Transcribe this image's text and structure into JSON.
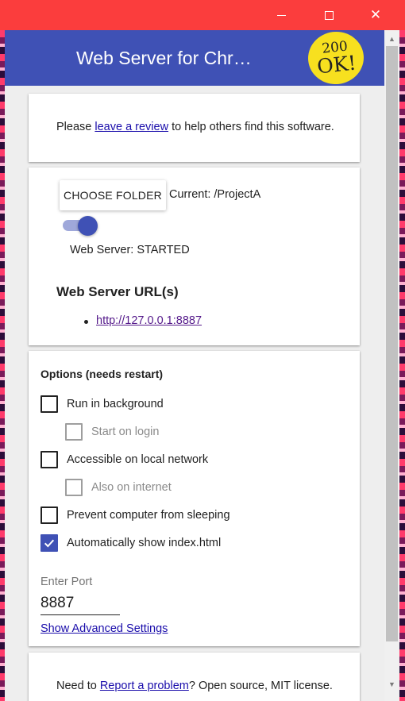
{
  "window": {
    "minimize_symbol": "",
    "close_symbol": "✕"
  },
  "appbar": {
    "title": "Web Server for Chr…",
    "badge_line1": "200",
    "badge_line2": "OK!"
  },
  "review": {
    "prefix": "Please ",
    "link": "leave a review",
    "suffix": " to help others find this software."
  },
  "server": {
    "choose_folder_label": "CHOOSE FOLDER",
    "current_folder": "Current: /ProjectA",
    "toggle_on": true,
    "status": "Web Server: STARTED",
    "urls_heading": "Web Server URL(s)",
    "urls": [
      "http://127.0.0.1:8887"
    ]
  },
  "options": {
    "heading": "Options (needs restart)",
    "items": [
      {
        "label": "Run in background",
        "checked": false,
        "disabled": false
      },
      {
        "label": "Start on login",
        "checked": false,
        "disabled": true
      },
      {
        "label": "Accessible on local network",
        "checked": false,
        "disabled": false
      },
      {
        "label": "Also on internet",
        "checked": false,
        "disabled": true
      },
      {
        "label": "Prevent computer from sleeping",
        "checked": false,
        "disabled": false
      },
      {
        "label": "Automatically show index.html",
        "checked": true,
        "disabled": false
      }
    ],
    "port_label": "Enter Port",
    "port_value": "8887",
    "advanced_link": "Show Advanced Settings"
  },
  "footer": {
    "prefix": "Need to ",
    "link": "Report a problem",
    "suffix": "? Open source, MIT license."
  },
  "colors": {
    "titlebar": "#fb3d3d",
    "appbar": "#3f51b5",
    "accent": "#3f51b5",
    "badge": "#f7e01f"
  }
}
